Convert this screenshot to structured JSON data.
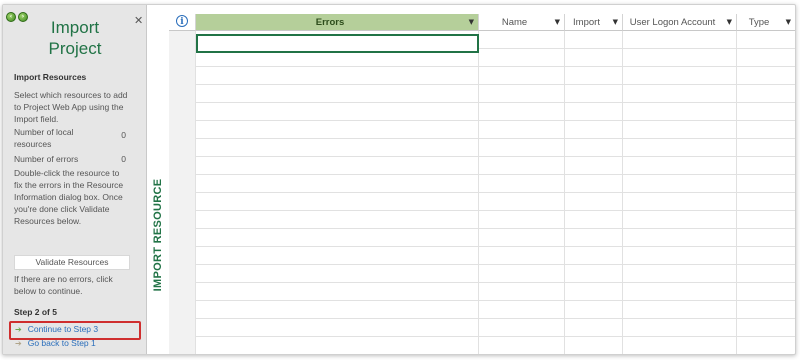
{
  "pane": {
    "title_line1": "Import",
    "title_line2": "Project",
    "close_glyph": "✕",
    "section_title": "Import Resources",
    "intro_text": "Select which resources to add to Project Web App using the Import field.",
    "local_resources_label": "Number of local resources",
    "local_resources_value": "0",
    "errors_label": "Number of errors",
    "errors_value": "0",
    "instructions": "Double-click the resource to fix the errors in the Resource Information dialog box. Once you're done click Validate Resources below.",
    "validate_button": "Validate Resources",
    "no_errors_text": "If there are no errors, click below to continue.",
    "step_title": "Step 2 of 5",
    "continue_link": "Continue to Step 3",
    "back_link": "Go back to Step 1"
  },
  "view_label": "IMPORT RESOURCE",
  "grid": {
    "info_icon": "i",
    "columns": [
      {
        "label": "Errors",
        "has_dropdown": true
      },
      {
        "label": "Name",
        "has_dropdown": true
      },
      {
        "label": "Import",
        "has_dropdown": true
      },
      {
        "label": "User Logon Account",
        "has_dropdown": true
      },
      {
        "label": "Type",
        "has_dropdown": true
      }
    ],
    "dropdown_glyph": "▼"
  },
  "colors": {
    "accent_green": "#217346",
    "errors_header_bg": "#b5cf9a",
    "link_blue": "#2a6ebb",
    "highlight_red": "#cf2e2e"
  }
}
